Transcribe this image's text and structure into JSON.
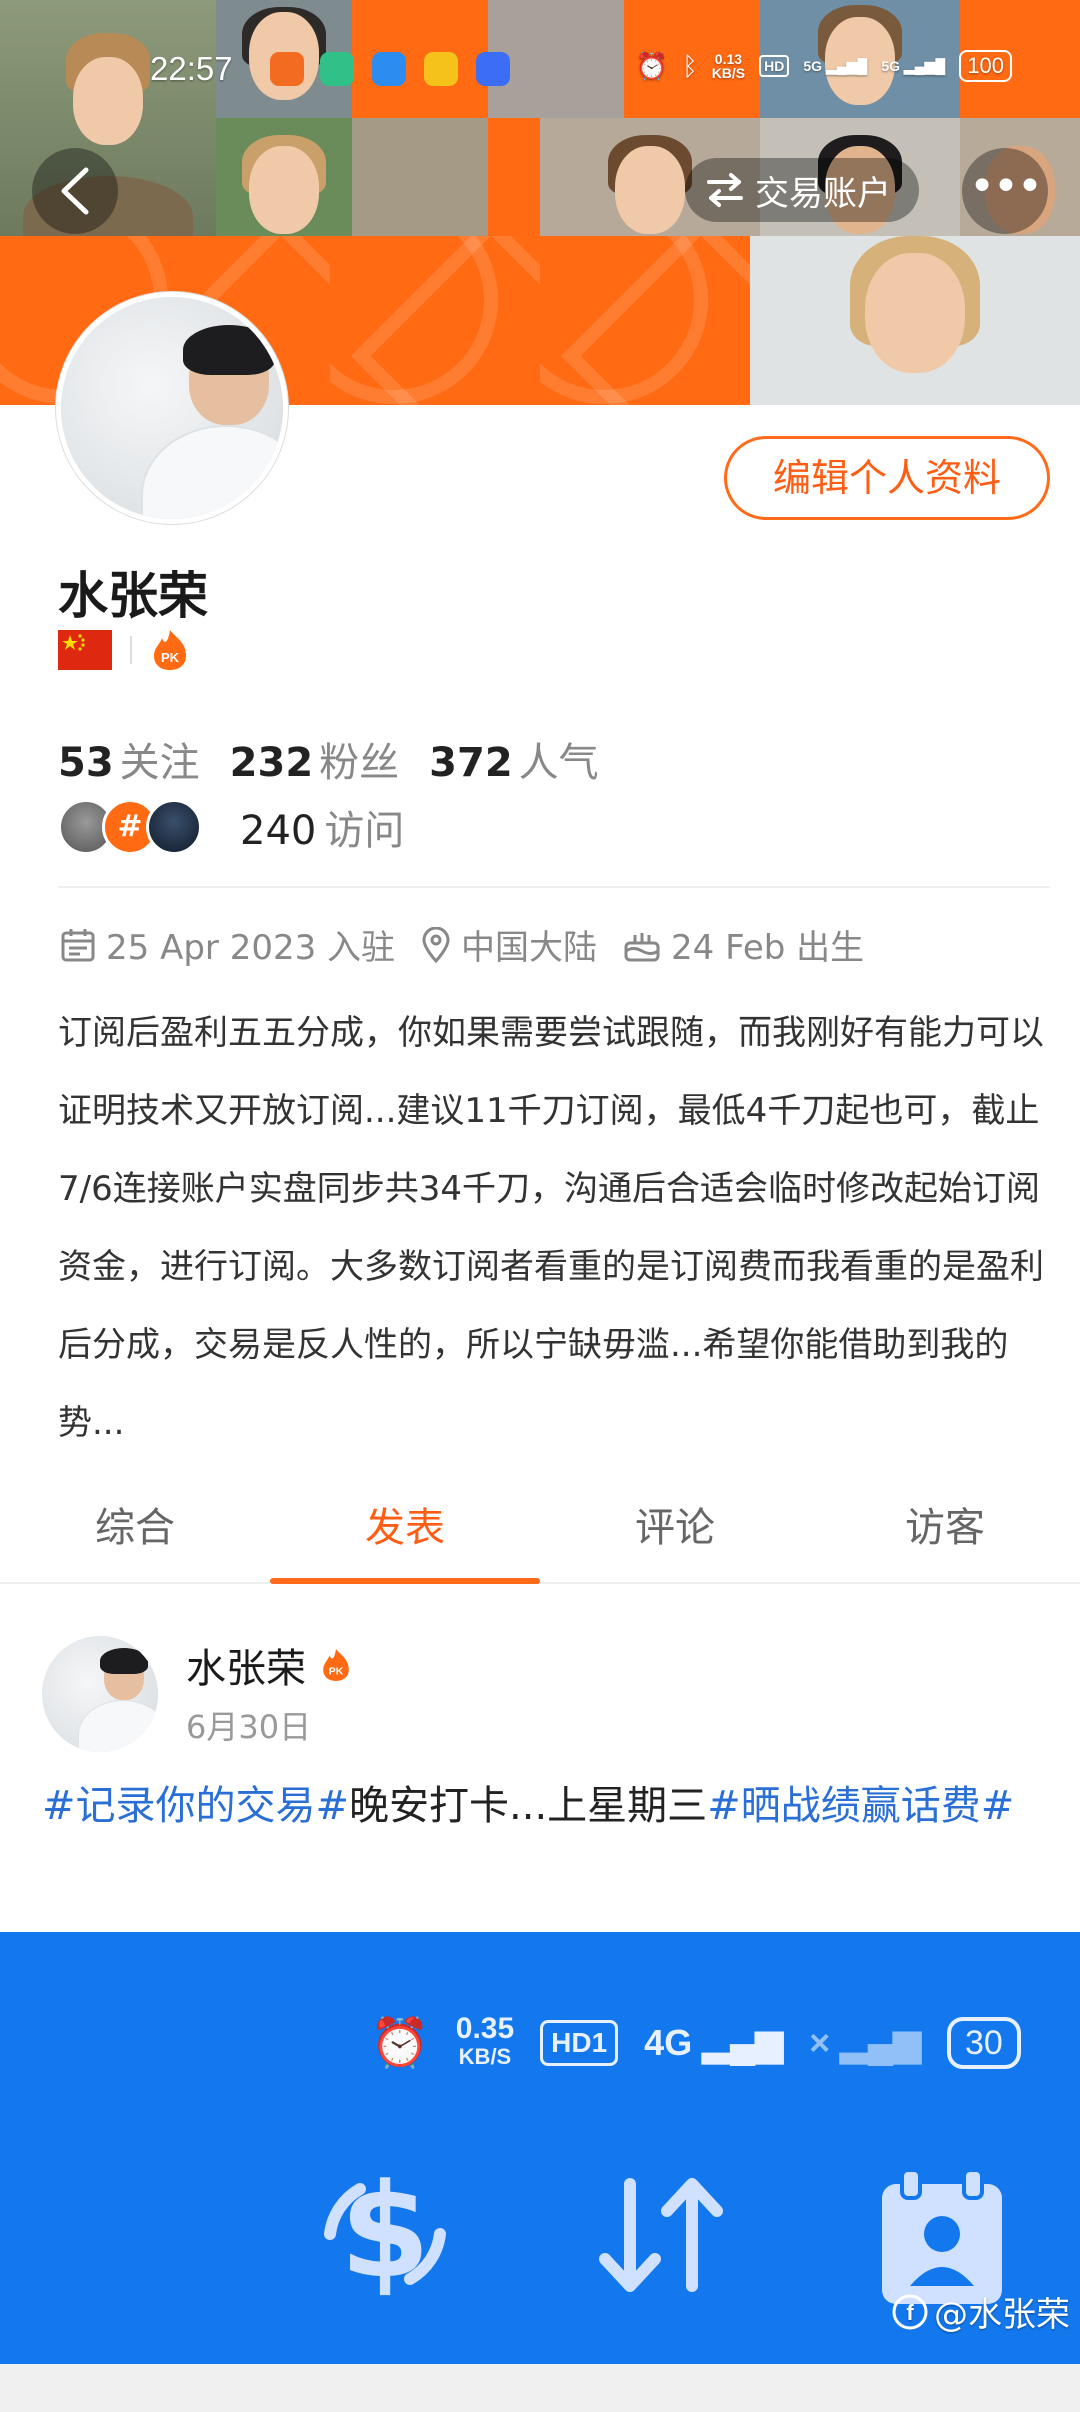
{
  "status_bar": {
    "time": "22:57",
    "net_speed": "0.13",
    "net_unit": "KB/S",
    "hd_label": "HD",
    "signal1": "5G",
    "signal2": "5G",
    "battery": "100"
  },
  "header": {
    "switch_account_label": "交易账户",
    "more_label": "•••",
    "switch_icon": "swap-arrows-icon"
  },
  "profile": {
    "edit_button": "编辑个人资料",
    "name": "水张荣",
    "stats": [
      {
        "value": "53",
        "label": "关注"
      },
      {
        "value": "232",
        "label": "粉丝"
      },
      {
        "value": "372",
        "label": "人气"
      }
    ],
    "visits": {
      "value": "240",
      "label": "访问"
    },
    "joined": "25 Apr 2023 入驻",
    "location": "中国大陆",
    "birthday": "24 Feb 出生",
    "bio": "订阅后盈利五五分成，你如果需要尝试跟随，而我刚好有能力可以证明技术又开放订阅...建议11千刀订阅，最低4千刀起也可，截止7/6连接账户实盘同步共34千刀，沟通后合适会临时修改起始订阅资金，进行订阅。大多数订阅者看重的是订阅费而我看重的是盈利后分成，交易是反人性的，所以宁缺毋滥...希望你能借助到我的势..."
  },
  "tabs": [
    {
      "label": "综合",
      "active": false
    },
    {
      "label": "发表",
      "active": true
    },
    {
      "label": "评论",
      "active": false
    },
    {
      "label": "访客",
      "active": false
    }
  ],
  "post": {
    "author": "水张荣",
    "date": "6月30日",
    "tag1": "#记录你的交易#",
    "text_mid": "晚安打卡...上星期三",
    "tag2": "#晒战绩赢话费#"
  },
  "post_image": {
    "speed": "0.35",
    "speed_unit": "KB/S",
    "hd_label": "HD1",
    "signal": "4G",
    "battery": "30",
    "watermark": "@水张荣"
  },
  "colors": {
    "accent": "#ff5d14",
    "hashtag": "#2a6fd6",
    "image_bg": "#1378ee"
  }
}
